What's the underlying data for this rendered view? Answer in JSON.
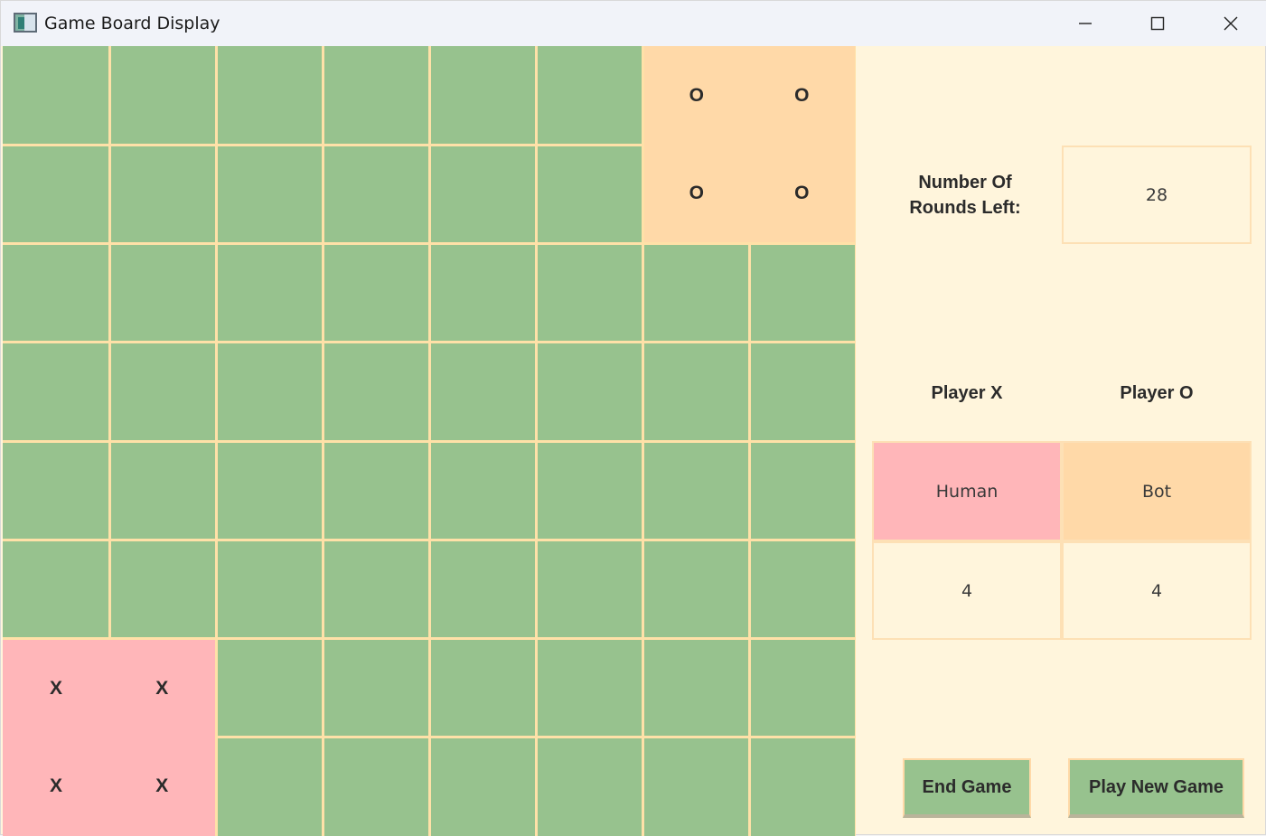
{
  "window": {
    "title": "Game Board Display",
    "app_icon": "app-window-icon",
    "controls": [
      "minimize-icon",
      "maximize-icon",
      "close-icon"
    ]
  },
  "board": {
    "rows": 8,
    "cols": 8,
    "cells": [
      [
        "",
        "",
        "",
        "",
        "",
        "",
        "O",
        "O"
      ],
      [
        "",
        "",
        "",
        "",
        "",
        "",
        "O",
        "O"
      ],
      [
        "",
        "",
        "",
        "",
        "",
        "",
        "",
        ""
      ],
      [
        "",
        "",
        "",
        "",
        "",
        "",
        "",
        ""
      ],
      [
        "",
        "",
        "",
        "",
        "",
        "",
        "",
        ""
      ],
      [
        "",
        "",
        "",
        "",
        "",
        "",
        "",
        ""
      ],
      [
        "X",
        "X",
        "",
        "",
        "",
        "",
        "",
        ""
      ],
      [
        "X",
        "X",
        "",
        "",
        "",
        "",
        "",
        ""
      ]
    ],
    "colors": {
      "empty": "#97c28e",
      "x": "#ffb6b9",
      "o": "#ffd9a8",
      "grid": "#ffe1a8"
    }
  },
  "rounds": {
    "label_line1": "Number Of",
    "label_line2": "Rounds Left:",
    "value": "28"
  },
  "players": {
    "x_header": "Player X",
    "o_header": "Player O",
    "x_type": "Human",
    "o_type": "Bot",
    "x_score": "4",
    "o_score": "4"
  },
  "actions": {
    "end_game": "End Game",
    "play_new_game": "Play New Game"
  },
  "colors": {
    "panel_bg": "#fff5dc",
    "titlebar_bg": "#f1f3f9",
    "button_green": "#97c28e"
  }
}
